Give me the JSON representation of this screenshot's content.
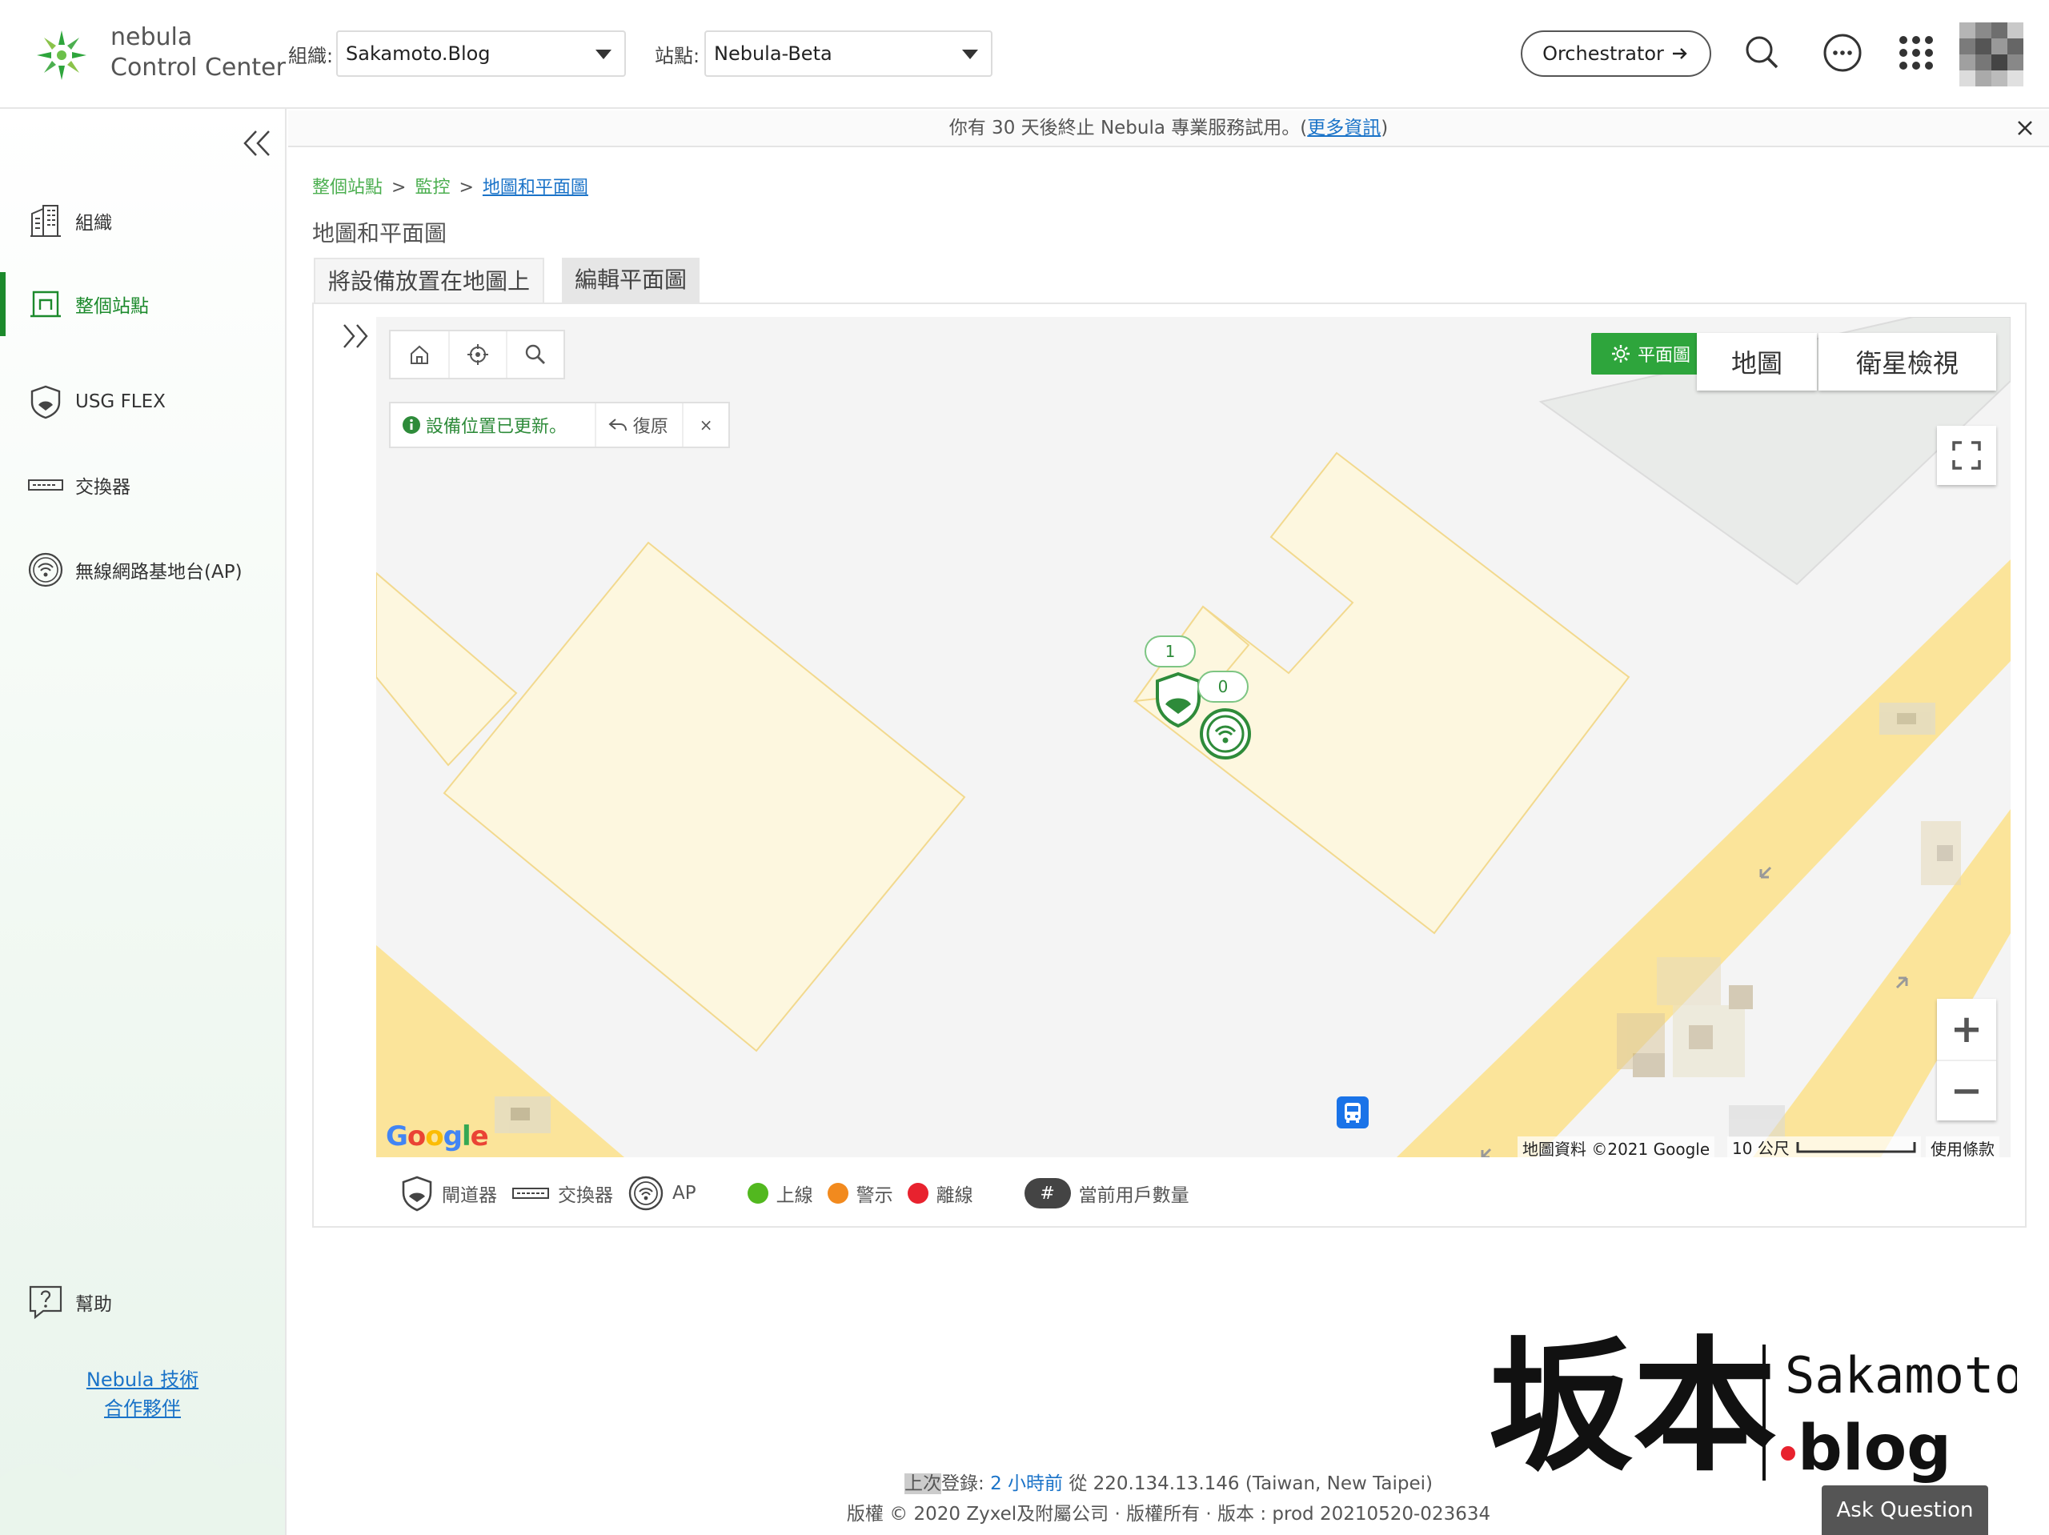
{
  "app": {
    "logo_line1": "nebula",
    "logo_line2": "Control Center"
  },
  "header": {
    "org_label": "組織:",
    "org_value": "Sakamoto.Blog",
    "site_label": "站點:",
    "site_value": "Nebula-Beta",
    "orchestrator_label": "Orchestrator",
    "icons": [
      "search-icon",
      "chat-icon",
      "apps-grid-icon",
      "avatar"
    ]
  },
  "sidebar": {
    "items": [
      {
        "label": "組織",
        "icon": "building-icon"
      },
      {
        "label": "整個站點",
        "icon": "site-icon",
        "active": true
      },
      {
        "label": "USG FLEX",
        "icon": "shield-icon"
      },
      {
        "label": "交換器",
        "icon": "switch-icon"
      },
      {
        "label": "無線網路基地台(AP)",
        "icon": "wifi-icon"
      }
    ],
    "help_label": "幫助",
    "partner_line1": "Nebula 技術",
    "partner_line2": "合作夥伴"
  },
  "banner": {
    "text_before": "你有 30 天後終止 Nebula 專業服務試用。(",
    "link": "更多資訊",
    "text_after": ")"
  },
  "breadcrumb": {
    "item1": "整個站點",
    "item2": "監控",
    "current": "地圖和平面圖",
    "separator": ">"
  },
  "page": {
    "title": "地圖和平面圖",
    "tabs": [
      "將設備放置在地圖上",
      "編輯平面圖"
    ]
  },
  "map": {
    "notice": "設備位置已更新。",
    "undo": "復原",
    "close": "×",
    "floorplan_btn": "平面圖",
    "map_type_map": "地圖",
    "map_type_satellite": "衛星檢視",
    "zoom_in": "+",
    "zoom_out": "−",
    "attribution": "地圖資料 ©2021 Google",
    "scale": "10 公尺",
    "terms": "使用條款",
    "google": "Google",
    "gateway_count": "1",
    "ap_count": "0"
  },
  "legend": {
    "gateway": "閘道器",
    "switch": "交換器",
    "ap": "AP",
    "online": "上線",
    "warning": "警示",
    "offline": "離線",
    "clients_symbol": "#",
    "clients": "當前用戶數量",
    "colors": {
      "online": "#52b81f",
      "warning": "#f28a1e",
      "offline": "#e8222e"
    }
  },
  "footer": {
    "last_login_prefix": "上次",
    "last_login_label": "登錄:",
    "last_login_time": "2 小時前",
    "last_login_from": "從 220.134.13.146 (Taiwan, New Taipei)",
    "copyright": "版權 © 2020 Zyxel及附屬公司 · 版權所有 · 版本 :  prod 20210520-023634",
    "ask_button": "Ask Question"
  },
  "watermark": {
    "chinese": "坂本",
    "latin1": "Sakamoto",
    "latin2": ".blog"
  }
}
